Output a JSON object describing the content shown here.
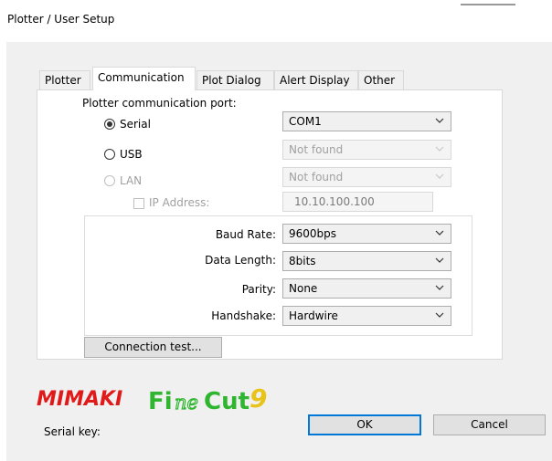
{
  "window": {
    "title": "Plotter / User Setup"
  },
  "tabs": [
    {
      "label": "Plotter",
      "active": false
    },
    {
      "label": "Communication",
      "active": true
    },
    {
      "label": "Plot Dialog",
      "active": false
    },
    {
      "label": "Alert Display",
      "active": false
    },
    {
      "label": "Other",
      "active": false
    }
  ],
  "communication": {
    "port_heading": "Plotter communication port:",
    "serial": {
      "label": "Serial",
      "selected": true,
      "port": "COM1"
    },
    "usb": {
      "label": "USB",
      "selected": false,
      "port": "Not found"
    },
    "lan": {
      "label": "LAN",
      "selected": false,
      "enabled": false,
      "port": "Not found"
    },
    "ip": {
      "label": "IP Address:",
      "value": "10.10.100.100",
      "checked": false
    },
    "baud_rate": {
      "label": "Baud Rate:",
      "value": "9600bps"
    },
    "data_length": {
      "label": "Data Length:",
      "value": "8bits"
    },
    "parity": {
      "label": "Parity:",
      "value": "None"
    },
    "handshake": {
      "label": "Handshake:",
      "value": "Hardwire"
    },
    "connection_test": "Connection test..."
  },
  "logo": {
    "brand": "MIMAKI",
    "product_a": "Fi",
    "product_b": "ne",
    "product_c": "Cut",
    "version": "9"
  },
  "serial_key_label": "Serial key:",
  "buttons": {
    "ok": "OK",
    "cancel": "Cancel"
  },
  "colors": {
    "mimaki_red": "#e01919",
    "finecut_green": "#2fb52f",
    "accent_blue": "#0078d7"
  }
}
